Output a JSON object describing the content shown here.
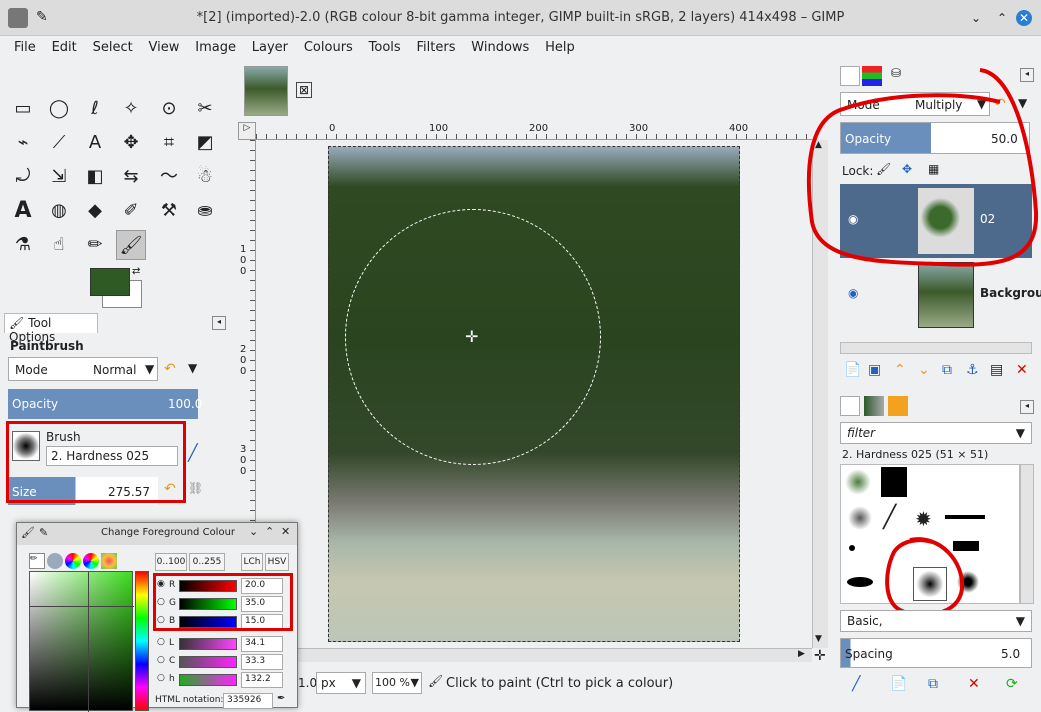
{
  "window": {
    "title": "*[2] (imported)-2.0 (RGB colour 8-bit gamma integer, GIMP built-in sRGB, 2 layers) 414x498 – GIMP"
  },
  "menu": [
    "File",
    "Edit",
    "Select",
    "View",
    "Image",
    "Layer",
    "Colours",
    "Tools",
    "Filters",
    "Windows",
    "Help"
  ],
  "tool_options": {
    "tab_label": "Tool Options",
    "tool_name": "Paintbrush",
    "mode_label": "Mode",
    "mode_value": "Normal",
    "opacity_label": "Opacity",
    "opacity_value": "100.0",
    "brush_label": "Brush",
    "brush_value": "2. Hardness 025",
    "size_label": "Size",
    "size_value": "275.57"
  },
  "colors": {
    "fg": "#2f5a24",
    "bg": "#ffffff",
    "accent": "#6a8fbc",
    "highlight": "#4d6a8c",
    "red_marker": "#e00000"
  },
  "ruler": {
    "h_ticks": [
      "0",
      "100",
      "200",
      "300",
      "400"
    ],
    "v_ticks": [
      "1 0 0",
      "2 0 0",
      "3 0 0"
    ]
  },
  "status": {
    "unit_value": "1.0",
    "unit": "px",
    "zoom": "100 %",
    "message": "Click to paint (Ctrl to pick a colour)"
  },
  "layers_panel": {
    "mode_label": "Mode",
    "mode_value": "Multiply",
    "opacity_label": "Opacity",
    "opacity_value": "50.0",
    "lock_label": "Lock:",
    "layers": [
      {
        "name": "02"
      },
      {
        "name": "Backgrou"
      }
    ]
  },
  "brushes_panel": {
    "filter_placeholder": "filter",
    "brush_title": "2. Hardness 025 (51 × 51)",
    "preset": "Basic,",
    "spacing_label": "Spacing",
    "spacing_value": "5.0"
  },
  "fg_dialog": {
    "title": "Change Foreground Colour",
    "range_tabs": [
      "0..100",
      "0..255"
    ],
    "model_tabs": [
      "LCh",
      "HSV"
    ],
    "rgb": [
      {
        "label": "R",
        "value": "20.0"
      },
      {
        "label": "G",
        "value": "35.0"
      },
      {
        "label": "B",
        "value": "15.0"
      }
    ],
    "lch": [
      {
        "label": "L",
        "value": "34.1"
      },
      {
        "label": "C",
        "value": "33.3"
      },
      {
        "label": "h",
        "value": "132.2"
      }
    ],
    "html_label": "HTML notation:",
    "html_value": "335926"
  }
}
